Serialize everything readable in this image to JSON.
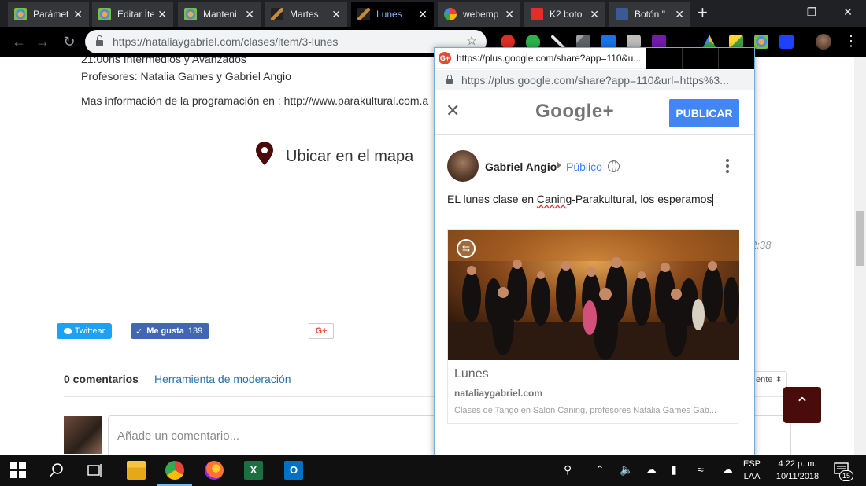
{
  "browser": {
    "tabs": [
      {
        "label": "Parámet",
        "favicon": "joomla-icon",
        "active": false
      },
      {
        "label": "Editar Íte",
        "favicon": "joomla-icon",
        "active": false
      },
      {
        "label": "Manteni",
        "favicon": "joomla-icon",
        "active": false
      },
      {
        "label": "Martes",
        "favicon": "site-icon",
        "active": false
      },
      {
        "label": "Lunes",
        "favicon": "site-icon",
        "active": true
      },
      {
        "label": "webemp",
        "favicon": "google-icon",
        "active": false
      },
      {
        "label": "K2 boto",
        "favicon": "k2-icon",
        "active": false
      },
      {
        "label": "Botón \"",
        "favicon": "facebook-icon",
        "active": false
      }
    ],
    "new_tab": "+",
    "close_glyph": "✕",
    "url_domain": "https://nataliaygabriel.com",
    "url_path": "/clases/item/3-lunes"
  },
  "page": {
    "line_schedule": "21:00hs Intermedios y Avanzados",
    "line_teachers": "Profesores: Natalia Games y Gabriel Angio",
    "line_more_prefix": "Mas información de la programación en :",
    "line_more_link": "http://www.parakultural.com.a",
    "map_label": "Ubicar en el mapa",
    "time_fragment": "2:38",
    "tweet_label": "Twittear",
    "like_label": "Me gusta",
    "like_count": "139",
    "gplus_label": "G+",
    "comments_count": "0 comentarios",
    "moderation_link": "Herramienta de moderación",
    "sort_fragment": "ente ⬍",
    "comment_placeholder": "Añade un comentario...",
    "scroll_top_glyph": "⌃"
  },
  "popup": {
    "title_url": "https://plus.google.com/share?app=110&u...",
    "address_url": "https://plus.google.com/share?app=110&url=https%3...",
    "logo": "Google+",
    "publish_label": "PUBLICAR",
    "user_name": "Gabriel Angio",
    "audience": "Público",
    "post_text_a": "EL lunes clase en ",
    "post_text_b": "Caning",
    "post_text_c": "-Parakultural, los esperamos",
    "card_title": "Lunes",
    "card_host": "nataliaygabriel.com",
    "card_desc": "Clases de Tango en Salon Caning, profesores Natalia Games Gab..."
  },
  "taskbar": {
    "lang_top": "ESP",
    "lang_bottom": "LAA",
    "time": "4:22 p. m.",
    "date": "10/11/2018",
    "notifications": "15"
  },
  "colors": {
    "gplus_blue": "#4285f4",
    "scroll_top_bg": "#4a0b0b",
    "link_blue": "#2e6ea4"
  }
}
